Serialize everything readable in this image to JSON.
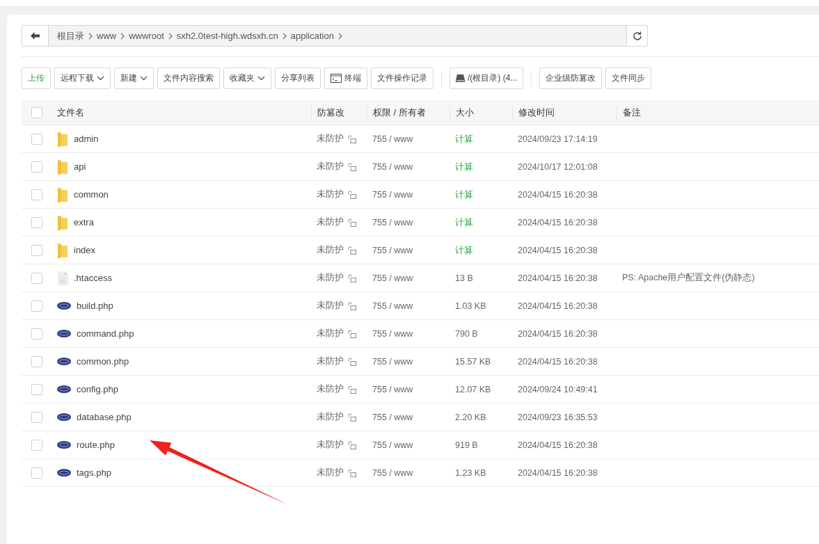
{
  "breadcrumb": {
    "items": [
      "根目录",
      "www",
      "wwwroot",
      "sxh2.0test-high.wdsxh.cn",
      "application"
    ]
  },
  "toolbar": {
    "groups": [
      [
        {
          "label": "上传",
          "kind": "primary",
          "dropdown": false
        },
        {
          "label": "远程下载",
          "kind": "plain",
          "dropdown": true
        },
        {
          "label": "新建",
          "kind": "plain",
          "dropdown": true
        },
        {
          "label": "文件内容搜索",
          "kind": "plain",
          "dropdown": false
        },
        {
          "label": "收藏夹",
          "kind": "plain",
          "dropdown": true
        },
        {
          "label": "分享列表",
          "kind": "plain",
          "dropdown": false
        },
        {
          "label": "终端",
          "kind": "terminal",
          "dropdown": false
        },
        {
          "label": "文件操作记录",
          "kind": "plain",
          "dropdown": false
        }
      ],
      [
        {
          "label": "/(根目录) (4...",
          "kind": "disk",
          "dropdown": false
        }
      ],
      [
        {
          "label": "企业级防篡改",
          "kind": "plain",
          "dropdown": false
        },
        {
          "label": "文件同步",
          "kind": "plain",
          "dropdown": false
        }
      ]
    ]
  },
  "table": {
    "select_all_checked": false,
    "columns": [
      "文件名",
      "防篡改",
      "权限 / 所有者",
      "大小",
      "修改时间",
      "备注"
    ],
    "rows": [
      {
        "kind": "folder",
        "name": "admin",
        "protect": "未防护",
        "perm": "755 / www",
        "size": "计算",
        "mtime": "2024/09/23 17:14:19",
        "checked": false
      },
      {
        "kind": "folder",
        "name": "api",
        "protect": "未防护",
        "perm": "755 / www",
        "size": "计算",
        "mtime": "2024/10/17 12:01:08",
        "checked": false
      },
      {
        "kind": "folder",
        "name": "common",
        "protect": "未防护",
        "perm": "755 / www",
        "size": "计算",
        "mtime": "2024/04/15 16:20:38",
        "checked": false
      },
      {
        "kind": "folder",
        "name": "extra",
        "protect": "未防护",
        "perm": "755 / www",
        "size": "计算",
        "mtime": "2024/04/15 16:20:38",
        "checked": false
      },
      {
        "kind": "folder",
        "name": "index",
        "protect": "未防护",
        "perm": "755 / www",
        "size": "计算",
        "mtime": "2024/04/15 16:20:38",
        "checked": false
      },
      {
        "kind": "file",
        "name": ".htaccess",
        "protect": "未防护",
        "perm": "755 / www",
        "size": "13 B",
        "mtime": "2024/04/15 16:20:38",
        "note": "PS: Apache用户配置文件(伪静态)",
        "checked": false
      },
      {
        "kind": "php",
        "name": "build.php",
        "protect": "未防护",
        "perm": "755 / www",
        "size": "1.03 KB",
        "mtime": "2024/04/15 16:20:38",
        "checked": false
      },
      {
        "kind": "php",
        "name": "command.php",
        "protect": "未防护",
        "perm": "755 / www",
        "size": "790 B",
        "mtime": "2024/04/15 16:20:38",
        "checked": false
      },
      {
        "kind": "php",
        "name": "common.php",
        "protect": "未防护",
        "perm": "755 / www",
        "size": "15.57 KB",
        "mtime": "2024/04/15 16:20:38",
        "checked": false
      },
      {
        "kind": "php",
        "name": "config.php",
        "protect": "未防护",
        "perm": "755 / www",
        "size": "12.07 KB",
        "mtime": "2024/09/24 10:49:41",
        "checked": false
      },
      {
        "kind": "php",
        "name": "database.php",
        "protect": "未防护",
        "perm": "755 / www",
        "size": "2.20 KB",
        "mtime": "2024/09/23 16:35:53",
        "checked": false
      },
      {
        "kind": "php",
        "name": "route.php",
        "protect": "未防护",
        "perm": "755 / www",
        "size": "919 B",
        "mtime": "2024/04/15 16:20:38",
        "checked": false
      },
      {
        "kind": "php",
        "name": "tags.php",
        "protect": "未防护",
        "perm": "755 / www",
        "size": "1.23 KB",
        "mtime": "2024/04/15 16:20:38",
        "checked": false
      }
    ]
  }
}
